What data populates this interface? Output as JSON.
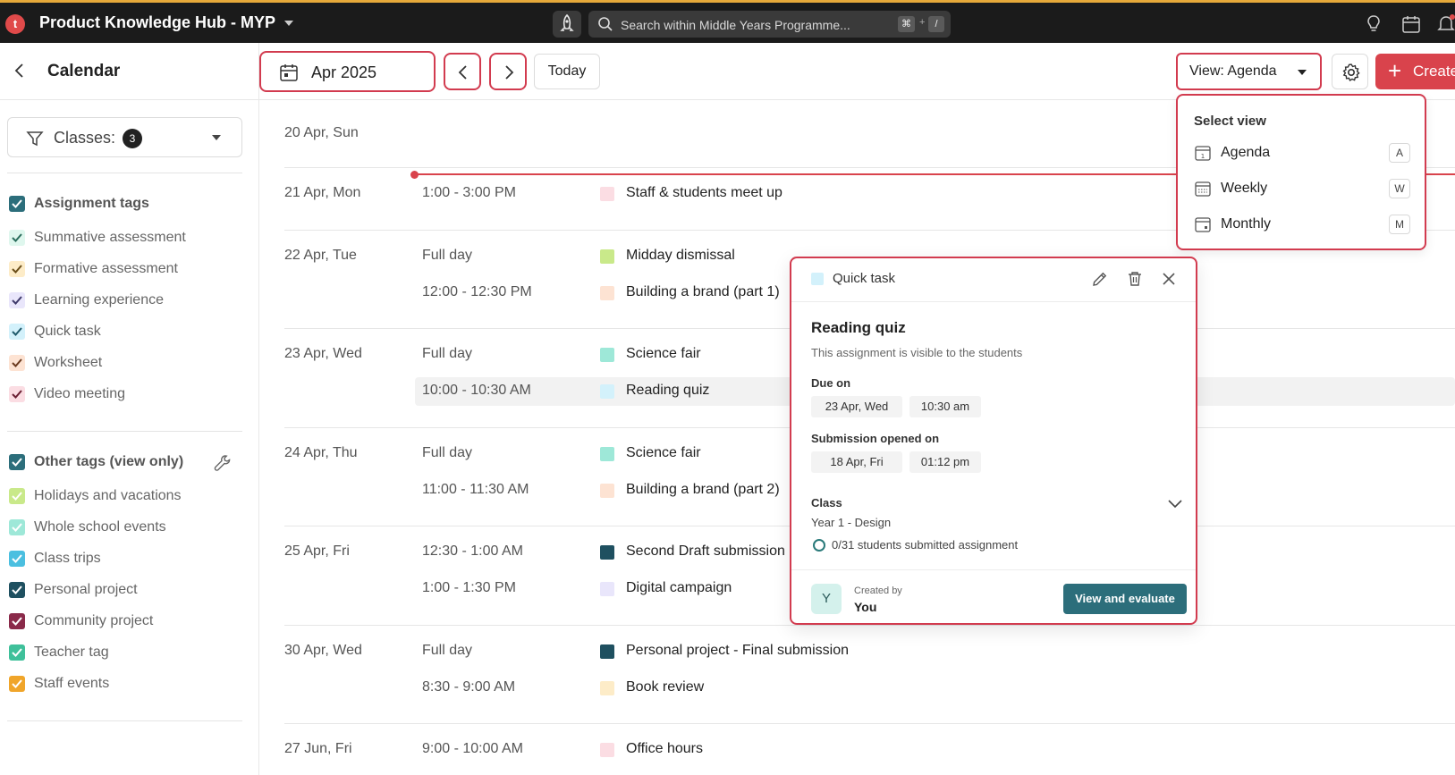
{
  "topbar": {
    "logo_letter": "t",
    "app_title": "Product Knowledge Hub - MYP",
    "search_placeholder": "Search within Middle Years Programme...",
    "shortcut_key1": "⌘",
    "shortcut_plus": "+",
    "shortcut_key2": "/"
  },
  "header": {
    "page_title": "Calendar",
    "date_picker_value": "Apr 2025",
    "today_label": "Today",
    "view_label": "View: Agenda",
    "create_label": "Create"
  },
  "sidebar": {
    "class_filter_label": "Classes:",
    "class_filter_count": "3",
    "assignment_tags_heading": "Assignment tags",
    "assignment_tags": [
      {
        "label": "Summative assessment",
        "color": "#dff7ee",
        "check": "#2b6e5d"
      },
      {
        "label": "Formative assessment",
        "color": "#fdecc8",
        "check": "#6b4f1a"
      },
      {
        "label": "Learning experience",
        "color": "#e9e6fb",
        "check": "#3f3a6b"
      },
      {
        "label": "Quick task",
        "color": "#d3f1fb",
        "check": "#1f5a6b"
      },
      {
        "label": "Worksheet",
        "color": "#fde3d3",
        "check": "#6b3a1f"
      },
      {
        "label": "Video meeting",
        "color": "#fbdde3",
        "check": "#6b1f33"
      }
    ],
    "other_tags_heading": "Other tags (view only)",
    "other_tags": [
      {
        "label": "Holidays and vacations",
        "color": "#c9e98a",
        "check": "#ffffff"
      },
      {
        "label": "Whole school events",
        "color": "#9ee8d8",
        "check": "#ffffff"
      },
      {
        "label": "Class trips",
        "color": "#4bbfe0",
        "check": "#ffffff"
      },
      {
        "label": "Personal project",
        "color": "#1f5060",
        "check": "#ffffff"
      },
      {
        "label": "Community project",
        "color": "#8a2a4a",
        "check": "#ffffff"
      },
      {
        "label": "Teacher tag",
        "color": "#3fc09a",
        "check": "#ffffff"
      },
      {
        "label": "Staff events",
        "color": "#f0a52a",
        "check": "#ffffff"
      }
    ]
  },
  "agenda": {
    "days": [
      {
        "label": "20 Apr, Sun",
        "events": []
      },
      {
        "label": "21 Apr, Mon",
        "events": [
          {
            "time": "1:00 - 3:00 PM",
            "title": "Staff & students meet up",
            "color": "#fbdde3"
          }
        ]
      },
      {
        "label": "22 Apr, Tue",
        "events": [
          {
            "time": "Full day",
            "title": "Midday dismissal",
            "color": "#c9e98a"
          },
          {
            "time": "12:00 - 12:30 PM",
            "title": "Building a brand (part 1)",
            "color": "#fde3d3"
          }
        ]
      },
      {
        "label": "23 Apr, Wed",
        "events": [
          {
            "time": "Full day",
            "title": "Science fair",
            "color": "#9ee8d8"
          },
          {
            "time": "10:00 - 10:30 AM",
            "title": "Reading quiz",
            "color": "#d3f1fb"
          }
        ]
      },
      {
        "label": "24 Apr, Thu",
        "events": [
          {
            "time": "Full day",
            "title": "Science fair",
            "color": "#9ee8d8"
          },
          {
            "time": "11:00 - 11:30 AM",
            "title": "Building a brand (part 2)",
            "color": "#fde3d3"
          }
        ]
      },
      {
        "label": "25 Apr, Fri",
        "events": [
          {
            "time": "12:30 - 1:00 AM",
            "title": "Second Draft submission",
            "color": "#1f5060"
          },
          {
            "time": "1:00 - 1:30 PM",
            "title": "Digital campaign",
            "color": "#e9e6fb"
          }
        ]
      },
      {
        "label": "30 Apr, Wed",
        "events": [
          {
            "time": "Full day",
            "title": "Personal project - Final submission",
            "color": "#1f5060"
          },
          {
            "time": "8:30 - 9:00 AM",
            "title": "Book review",
            "color": "#fdecc8"
          }
        ]
      },
      {
        "label": "27 Jun, Fri",
        "events": [
          {
            "time": "9:00 - 10:00 AM",
            "title": "Office hours",
            "color": "#fbdde3"
          }
        ]
      }
    ]
  },
  "view_menu": {
    "heading": "Select view",
    "items": [
      {
        "label": "Agenda",
        "key": "A"
      },
      {
        "label": "Weekly",
        "key": "W"
      },
      {
        "label": "Monthly",
        "key": "M"
      }
    ]
  },
  "task_popover": {
    "type": "Quick task",
    "title": "Reading quiz",
    "visibility": "This assignment is visible to the students",
    "due_label": "Due on",
    "due_date": "23 Apr, Wed",
    "due_time": "10:30 am",
    "submission_label": "Submission opened on",
    "submission_date": "18 Apr, Fri",
    "submission_time": "01:12 pm",
    "class_label": "Class",
    "class_value": "Year 1 - Design",
    "submitted_status": "0/31 students submitted assignment",
    "avatar_letter": "Y",
    "created_by_label": "Created by",
    "created_by_value": "You",
    "evaluate_button": "View and evaluate"
  }
}
